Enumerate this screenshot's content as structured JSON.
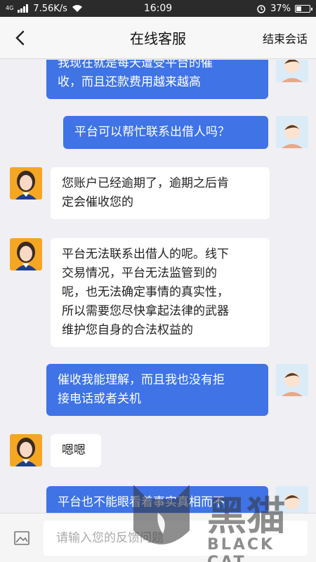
{
  "status_bar": {
    "signal": "4G",
    "speed": "7.56K/s",
    "time": "16:09",
    "battery": "37%",
    "battery_level": 0.37
  },
  "nav": {
    "title": "在线客服",
    "end_label": "结束会话"
  },
  "messages": [
    {
      "from": "me",
      "lines": [
        "我现在就是每天遭受平台的催",
        "收，而且还款费用越来越高"
      ]
    },
    {
      "from": "me",
      "lines": [
        "平台可以帮忙联系出借人吗？"
      ]
    },
    {
      "from": "agent",
      "lines": [
        "您账户已经逾期了，逾期之后肯",
        "定会催收您的"
      ]
    },
    {
      "from": "agent",
      "lines": [
        "平台无法联系出借人的呢。线下",
        "交易情况，平台无法监管到的",
        "呢，也无法确定事情的真实性，",
        "所以需要您尽快拿起法律的武器",
        "维护您自身的合法权益的"
      ]
    },
    {
      "from": "me",
      "lines": [
        "催收我能理解，而且我也没有拒",
        "接电话或者关机"
      ]
    },
    {
      "from": "agent",
      "lines": [
        "嗯嗯"
      ]
    },
    {
      "from": "me",
      "lines": [
        "平台也不能眼看着事实真相而不"
      ]
    }
  ],
  "input": {
    "placeholder": "请输入您的反馈问题"
  },
  "watermark": {
    "cn": "黑猫",
    "en": "BLACK CAT"
  },
  "colors": {
    "bubble_me": "#3f73e6",
    "bubble_agent": "#ffffff",
    "background": "#efeff4",
    "agent_avatar": "#f5a623"
  }
}
